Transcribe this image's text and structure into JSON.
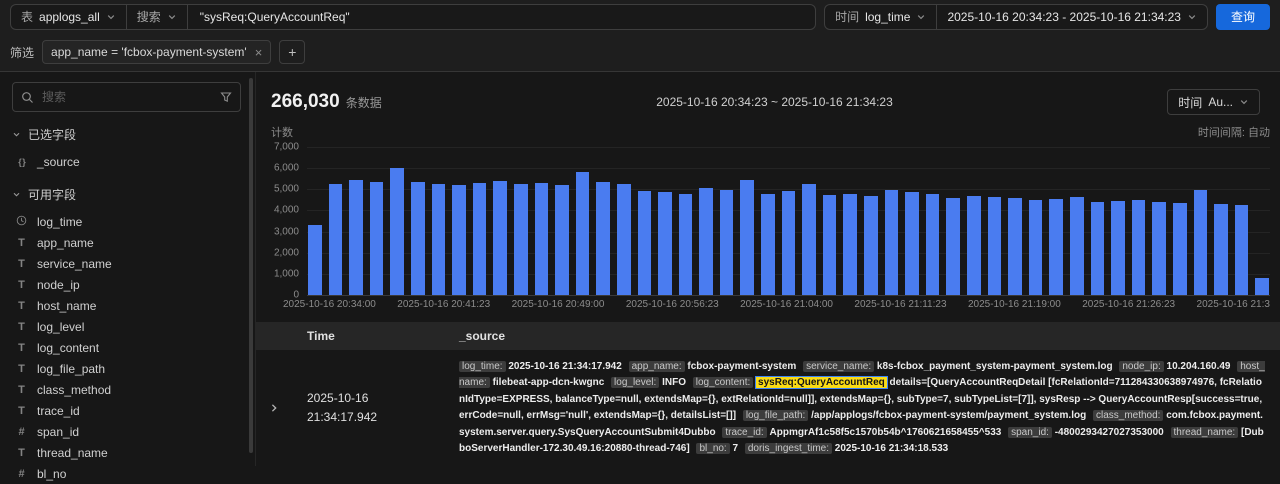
{
  "colors": {
    "accent": "#1668dc",
    "bar": "#4a7cf0",
    "highlight": "#fadb14"
  },
  "topbar": {
    "table_label": "表",
    "table_value": "applogs_all",
    "search_label": "搜索",
    "query_input": "\"sysReq:QueryAccountReq\"",
    "time_label": "时间",
    "time_field": "log_time",
    "time_range": "2025-10-16 20:34:23 - 2025-10-16 21:34:23",
    "query_button": "查询"
  },
  "filterbar": {
    "label": "筛选",
    "tag": "app_name = 'fcbox-payment-system'",
    "add_button": "+"
  },
  "sidebar": {
    "search_placeholder": "搜索",
    "selected_section": "已选字段",
    "available_section": "可用字段",
    "selected_fields": [
      {
        "icon": "braces",
        "name": "_source"
      }
    ],
    "available_fields": [
      {
        "icon": "clock",
        "name": "log_time"
      },
      {
        "icon": "text",
        "name": "app_name"
      },
      {
        "icon": "text",
        "name": "service_name"
      },
      {
        "icon": "text",
        "name": "node_ip"
      },
      {
        "icon": "text",
        "name": "host_name"
      },
      {
        "icon": "text",
        "name": "log_level"
      },
      {
        "icon": "text",
        "name": "log_content"
      },
      {
        "icon": "text",
        "name": "log_file_path"
      },
      {
        "icon": "text",
        "name": "class_method"
      },
      {
        "icon": "text",
        "name": "trace_id"
      },
      {
        "icon": "number",
        "name": "span_id"
      },
      {
        "icon": "text",
        "name": "thread_name"
      },
      {
        "icon": "number",
        "name": "bl_no"
      }
    ]
  },
  "results": {
    "count": "266,030",
    "count_suffix": "条数据",
    "range": "2025-10-16 20:34:23 ~ 2025-10-16 21:34:23",
    "time_button_label": "时间",
    "time_button_value": "Au..."
  },
  "chart_data": {
    "type": "bar",
    "title": "",
    "ylabel": "计数",
    "xlabel": "",
    "interval_label": "时间间隔: 自动",
    "ylim": [
      0,
      7000
    ],
    "y_ticks": [
      "7,000",
      "6,000",
      "5,000",
      "4,000",
      "3,000",
      "2,000",
      "1,000",
      "0"
    ],
    "x_labels": [
      "2025-10-16 20:34:00",
      "2025-10-16 20:41:23",
      "2025-10-16 20:49:00",
      "2025-10-16 20:56:23",
      "2025-10-16 21:04:00",
      "2025-10-16 21:11:23",
      "2025-10-16 21:19:00",
      "2025-10-16 21:26:23",
      "2025-10-16 21:3"
    ],
    "values": [
      3300,
      5250,
      5450,
      5350,
      6000,
      5350,
      5250,
      5200,
      5300,
      5400,
      5250,
      5300,
      5200,
      5800,
      5350,
      5250,
      4900,
      4850,
      4800,
      5050,
      4950,
      5450,
      4800,
      4900,
      5250,
      4750,
      4800,
      4700,
      4950,
      4850,
      4800,
      4600,
      4700,
      4650,
      4600,
      4500,
      4550,
      4650,
      4400,
      4450,
      4500,
      4400,
      4350,
      4950,
      4300,
      4250,
      800
    ],
    "bar_color": "#4a7cf0",
    "grid": true,
    "legend": false
  },
  "table": {
    "columns": [
      "Time",
      "_source"
    ],
    "row": {
      "time": "2025-10-16 21:34:17.942",
      "source_fields": [
        {
          "key": "log_time",
          "value": "2025-10-16 21:34:17.942"
        },
        {
          "key": "app_name",
          "value": "fcbox-payment-system"
        },
        {
          "key": "service_name",
          "value": "k8s-fcbox_payment_system-payment_system.log"
        },
        {
          "key": "node_ip",
          "value": "10.204.160.49"
        },
        {
          "key": "host_name",
          "value": "filebeat-app-dcn-kwgnc"
        },
        {
          "key": "log_level",
          "value": "INFO"
        },
        {
          "key": "log_content",
          "highlight": "sysReq:QueryAccountReq",
          "value": "details=[QueryAccountReqDetail [fcRelationId=711284330638974976, fcRelationIdType=EXPRESS, balanceType=null, extendsMap={}, extRelationId=null]], extendsMap={}, subType=7, subTypeList=[7]], sysResp --> QueryAccountResp[success=true, errCode=null, errMsg='null', extendsMap={}, detailsList=[]]"
        },
        {
          "key": "log_file_path",
          "value": "/app/applogs/fcbox-payment-system/payment_system.log"
        },
        {
          "key": "class_method",
          "value": "com.fcbox.payment.system.server.query.SysQueryAccountSubmit4Dubbo"
        },
        {
          "key": "trace_id",
          "value": "AppmgrAf1c58f5c1570b54b^1760621658455^533"
        },
        {
          "key": "span_id",
          "value": "-4800293427027353000"
        },
        {
          "key": "thread_name",
          "value": "[DubboServerHandler-172.30.49.16:20880-thread-746]"
        },
        {
          "key": "bl_no",
          "value": "7"
        },
        {
          "key": "doris_ingest_time",
          "value": "2025-10-16 21:34:18.533"
        }
      ]
    }
  }
}
